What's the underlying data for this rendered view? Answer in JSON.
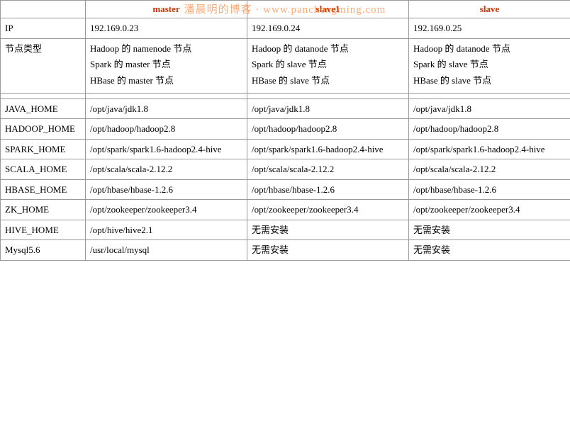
{
  "watermark": {
    "text": "潘晨明的博客 · www.panchengming.com"
  },
  "table": {
    "headers": {
      "label": "",
      "master": "master",
      "slave1": "slave1",
      "slave2": "slave"
    },
    "rows": [
      {
        "id": "ip",
        "label": "IP",
        "master": "192.169.0.23",
        "slave1": "192.169.0.24",
        "slave2": "192.169.0.25"
      },
      {
        "id": "node-type",
        "label": "节点类型",
        "master_lines": [
          "Hadoop 的 namenode 节点",
          "Spark 的 master 节点",
          "HBase 的 master 节点"
        ],
        "slave1_lines": [
          "Hadoop 的 datanode 节点",
          "Spark 的 slave 节点",
          "HBase 的 slave 节点"
        ],
        "slave2_lines": [
          "Hadoop 的 datanode 节点",
          "Spark 的 slave 节点",
          "HBase 的 slave 节点"
        ]
      },
      {
        "id": "java-home",
        "label": "JAVA_HOME",
        "master": "/opt/java/jdk1.8",
        "slave1": "/opt/java/jdk1.8",
        "slave2": "/opt/java/jdk1.8"
      },
      {
        "id": "hadoop-home",
        "label": "HADOOP_HOME",
        "master": "/opt/hadoop/hadoop2.8",
        "slave1": "/opt/hadoop/hadoop2.8",
        "slave2": "/opt/hadoop/hadoop2.8"
      },
      {
        "id": "spark-home",
        "label": "SPARK_HOME",
        "master": "/opt/spark/spark1.6-hadoop2.4-hive",
        "slave1": "/opt/spark/spark1.6-hadoop2.4-hive",
        "slave2": "/opt/spark/spark1.6-hadoop2.4-hive"
      },
      {
        "id": "scala-home",
        "label": "SCALA_HOME",
        "master": "/opt/scala/scala-2.12.2",
        "slave1": "/opt/scala/scala-2.12.2",
        "slave2": "/opt/scala/scala-2.12.2"
      },
      {
        "id": "hbase-home",
        "label": "HBASE_HOME",
        "master": "/opt/hbase/hbase-1.2.6",
        "slave1": "/opt/hbase/hbase-1.2.6",
        "slave2": "/opt/hbase/hbase-1.2.6"
      },
      {
        "id": "zk-home",
        "label": "ZK_HOME",
        "master": "/opt/zookeeper/zookeeper3.4",
        "slave1": "/opt/zookeeper/zookeeper3.4",
        "slave2": "/opt/zookeeper/zookeeper3.4"
      },
      {
        "id": "hive-home",
        "label": "HIVE_HOME",
        "master": "/opt/hive/hive2.1",
        "slave1": "无需安装",
        "slave2": "无需安装"
      },
      {
        "id": "mysql",
        "label": "Mysql5.6",
        "master": "/usr/local/mysql",
        "slave1": "无需安装",
        "slave2": "无需安装"
      }
    ]
  }
}
